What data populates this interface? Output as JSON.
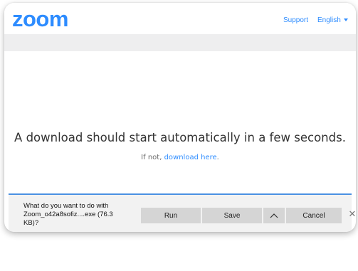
{
  "header": {
    "logo": "zoom",
    "nav": {
      "support": "Support",
      "language": "English"
    }
  },
  "main": {
    "headline": "A download should start automatically in a few seconds.",
    "subline_prefix": "If not, ",
    "subline_link": "download here",
    "subline_suffix": "."
  },
  "download_bar": {
    "prompt_line1": "What do you want to do with",
    "prompt_line2": "Zoom_o42a8sofiz....exe (76.3",
    "prompt_line3": "KB)?",
    "run_label": "Run",
    "save_label": "Save",
    "more_icon": "chevron-up-icon",
    "cancel_label": "Cancel",
    "close_icon": "close-icon"
  },
  "colors": {
    "brand": "#2d8cff",
    "band": "#eeeeef",
    "bar_accent": "#4a90e2"
  }
}
